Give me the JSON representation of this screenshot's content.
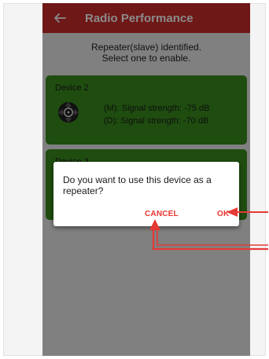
{
  "app": {
    "title": "Radio Performance",
    "back_icon": "arrow-left-icon",
    "accent_color": "#cc2d2b"
  },
  "main": {
    "subtitle_line1": "Repeater(slave) identified.",
    "subtitle_line2": "Select one to enable.",
    "devices": [
      {
        "name": "Device 2",
        "icon": "speaker-icon",
        "m_signal": "(M): Signal strength: -75 dB",
        "d_signal": "(D): Signal strength: -70 dB",
        "card_color": "#3a8f1f"
      },
      {
        "name": "Device 3",
        "card_color": "#3a8f1f"
      }
    ]
  },
  "dialog": {
    "message": "Do you want to use this device as a repeater?",
    "cancel_label": "CANCEL",
    "ok_label": "OK",
    "button_color": "#e8352f"
  },
  "annotations": {
    "arrow_color": "#e53935"
  }
}
